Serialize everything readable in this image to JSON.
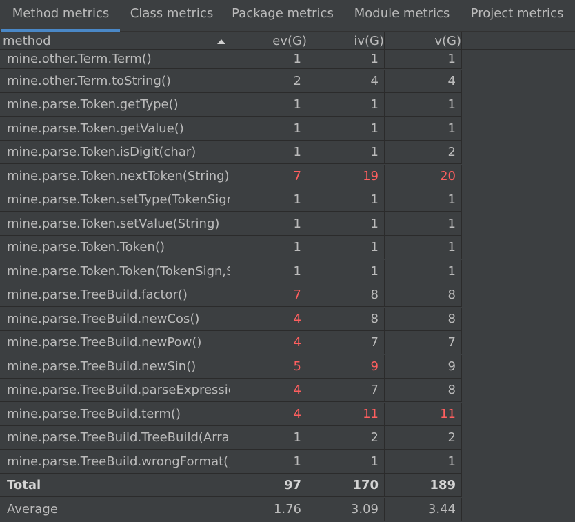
{
  "tabs": [
    {
      "label": "Method metrics",
      "active": true
    },
    {
      "label": "Class metrics",
      "active": false
    },
    {
      "label": "Package metrics",
      "active": false
    },
    {
      "label": "Module metrics",
      "active": false
    },
    {
      "label": "Project metrics",
      "active": false
    }
  ],
  "table": {
    "columns": [
      "method",
      "ev(G)",
      "iv(G)",
      "v(G)"
    ],
    "sort_column": "method",
    "sort_direction": "ascending",
    "highlight_color": "#ff5f5f",
    "rows": [
      {
        "name": "mine.other.Term.Term()",
        "ev": "1",
        "iv": "1",
        "v": "1",
        "hot": []
      },
      {
        "name": "mine.other.Term.toString()",
        "ev": "2",
        "iv": "4",
        "v": "4",
        "hot": []
      },
      {
        "name": "mine.parse.Token.getType()",
        "ev": "1",
        "iv": "1",
        "v": "1",
        "hot": []
      },
      {
        "name": "mine.parse.Token.getValue()",
        "ev": "1",
        "iv": "1",
        "v": "1",
        "hot": []
      },
      {
        "name": "mine.parse.Token.isDigit(char)",
        "ev": "1",
        "iv": "1",
        "v": "2",
        "hot": []
      },
      {
        "name": "mine.parse.Token.nextToken(String)",
        "ev": "7",
        "iv": "19",
        "v": "20",
        "hot": [
          "ev",
          "iv",
          "v"
        ]
      },
      {
        "name": "mine.parse.Token.setType(TokenSign)",
        "ev": "1",
        "iv": "1",
        "v": "1",
        "hot": []
      },
      {
        "name": "mine.parse.Token.setValue(String)",
        "ev": "1",
        "iv": "1",
        "v": "1",
        "hot": []
      },
      {
        "name": "mine.parse.Token.Token()",
        "ev": "1",
        "iv": "1",
        "v": "1",
        "hot": []
      },
      {
        "name": "mine.parse.Token.Token(TokenSign,St",
        "ev": "1",
        "iv": "1",
        "v": "1",
        "hot": []
      },
      {
        "name": "mine.parse.TreeBuild.factor()",
        "ev": "7",
        "iv": "8",
        "v": "8",
        "hot": [
          "ev"
        ]
      },
      {
        "name": "mine.parse.TreeBuild.newCos()",
        "ev": "4",
        "iv": "8",
        "v": "8",
        "hot": [
          "ev"
        ]
      },
      {
        "name": "mine.parse.TreeBuild.newPow()",
        "ev": "4",
        "iv": "7",
        "v": "7",
        "hot": [
          "ev"
        ]
      },
      {
        "name": "mine.parse.TreeBuild.newSin()",
        "ev": "5",
        "iv": "9",
        "v": "9",
        "hot": [
          "ev",
          "iv"
        ]
      },
      {
        "name": "mine.parse.TreeBuild.parseExpression",
        "ev": "4",
        "iv": "7",
        "v": "8",
        "hot": [
          "ev"
        ]
      },
      {
        "name": "mine.parse.TreeBuild.term()",
        "ev": "4",
        "iv": "11",
        "v": "11",
        "hot": [
          "ev",
          "iv",
          "v"
        ]
      },
      {
        "name": "mine.parse.TreeBuild.TreeBuild(Arrayl",
        "ev": "1",
        "iv": "2",
        "v": "2",
        "hot": []
      },
      {
        "name": "mine.parse.TreeBuild.wrongFormat()",
        "ev": "1",
        "iv": "1",
        "v": "1",
        "hot": []
      }
    ],
    "total": {
      "name": "Total",
      "ev": "97",
      "iv": "170",
      "v": "189"
    },
    "average": {
      "name": "Average",
      "ev": "1.76",
      "iv": "3.09",
      "v": "3.44"
    }
  }
}
